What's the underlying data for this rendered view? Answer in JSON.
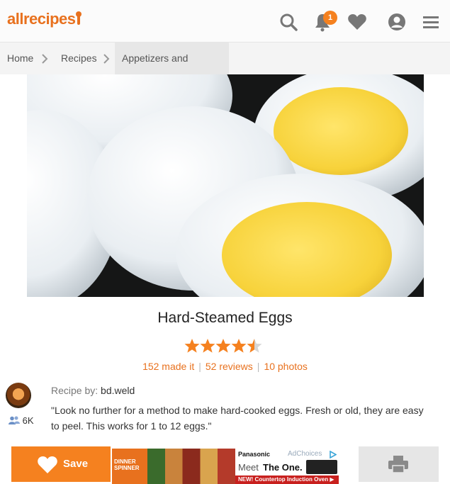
{
  "header": {
    "logo": "allrecipes",
    "notification_count": "1",
    "icons": [
      "search-icon",
      "bell-icon",
      "heart-icon",
      "user-icon",
      "menu-icon"
    ],
    "accent_color": "#f5811f"
  },
  "breadcrumb": [
    "Home",
    "Recipes",
    "Appetizers and Snacks"
  ],
  "recipe": {
    "title": "Hard-Steamed Eggs",
    "rating": 4.5,
    "made_it": "152 made it",
    "reviews": "52 reviews",
    "photos": "10 photos",
    "byline_label": "Recipe by:",
    "author": "bd.weld",
    "followers": "6K",
    "description": "\"Look no further for a method to make hard-cooked eggs. Fresh or old, they are easy to peel. This works for 1 to 12 eggs.\""
  },
  "footer": {
    "save_label": "Save",
    "ad": {
      "adchoices": "AdChoices",
      "brand": "Panasonic",
      "tagline_a": "Meet",
      "tagline_b": "The One.",
      "promo": "NEW! Countertop Induction Oven ▶",
      "product": "DINNER SPINNER"
    }
  }
}
